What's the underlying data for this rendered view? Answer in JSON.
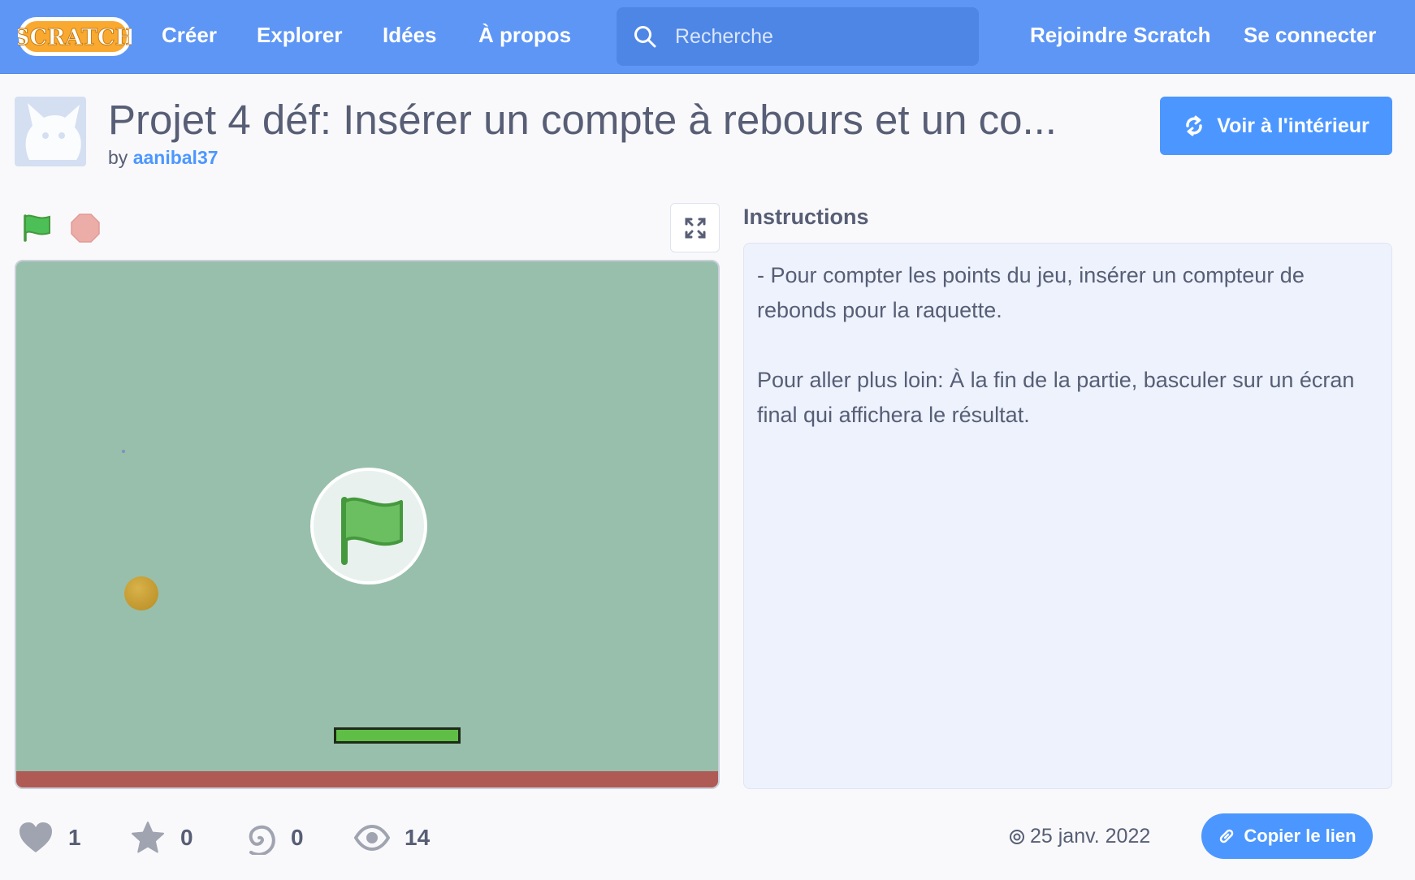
{
  "nav": {
    "logo_text": "SCRATCH",
    "links": [
      "Créer",
      "Explorer",
      "Idées",
      "À propos"
    ],
    "search_placeholder": "Recherche",
    "join": "Rejoindre Scratch",
    "signin": "Se connecter"
  },
  "project": {
    "title": "Projet 4 déf: Insérer un compte à rebours et un co...",
    "by_label": "by",
    "author": "aanibal37",
    "see_inside": "Voir à l'intérieur"
  },
  "instructions": {
    "heading": "Instructions",
    "paragraphs": [
      "- Pour compter les points du jeu, insérer un compteur de rebonds pour la raquette.",
      "Pour aller plus loin: À la fin de la partie, basculer sur un écran final qui affichera le résultat."
    ]
  },
  "stats": {
    "loves": "1",
    "favorites": "0",
    "remixes": "0",
    "views": "14"
  },
  "date": "25 janv. 2022",
  "copy_link": "Copier le lien",
  "colors": {
    "nav": "#5e96f6",
    "accent": "#4c97ff",
    "stage": "#98bfab",
    "floor": "#b05a56",
    "paddle": "#5ebe45"
  }
}
